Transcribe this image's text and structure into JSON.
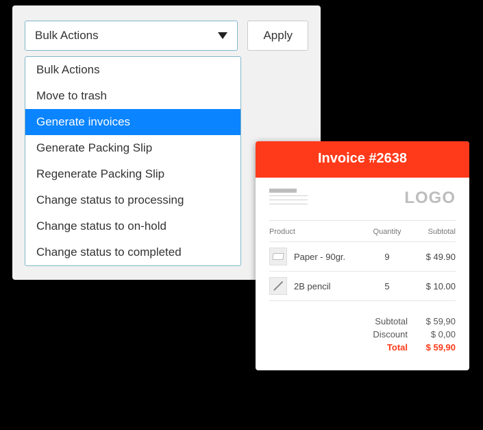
{
  "bulk": {
    "selected_label": "Bulk Actions",
    "apply_label": "Apply",
    "options": [
      {
        "label": "Bulk Actions",
        "highlighted": false
      },
      {
        "label": "Move to trash",
        "highlighted": false
      },
      {
        "label": "Generate invoices",
        "highlighted": true
      },
      {
        "label": "Generate Packing Slip",
        "highlighted": false
      },
      {
        "label": "Regenerate Packing Slip",
        "highlighted": false
      },
      {
        "label": "Change status to processing",
        "highlighted": false
      },
      {
        "label": "Change status to on-hold",
        "highlighted": false
      },
      {
        "label": "Change status to completed",
        "highlighted": false
      }
    ]
  },
  "invoice": {
    "title": "Invoice #2638",
    "logo_text": "LOGO",
    "columns": {
      "c1": "Product",
      "c2": "Quantity",
      "c3": "Subtotal"
    },
    "items": [
      {
        "name": "Paper - 90gr.",
        "qty": "9",
        "subtotal": "$ 49.90",
        "icon": "paper"
      },
      {
        "name": "2B pencil",
        "qty": "5",
        "subtotal": "$ 10.00",
        "icon": "pencil"
      }
    ],
    "totals": {
      "subtotal_label": "Subtotal",
      "subtotal_value": "$ 59,90",
      "discount_label": "Discount",
      "discount_value": "$ 0,00",
      "total_label": "Total",
      "total_value": "$ 59,90"
    }
  },
  "colors": {
    "accent_orange": "#ff3a1a",
    "highlight_blue": "#0a84ff"
  }
}
